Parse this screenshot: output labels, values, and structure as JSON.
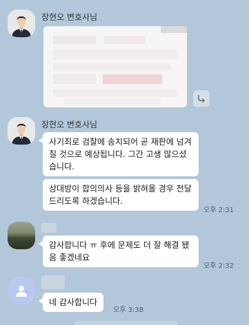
{
  "messages": [
    {
      "sender": "장현오 변호사님",
      "content_type": "image",
      "image_state": "blurred"
    },
    {
      "sender": "장현오 변호사님",
      "bubbles": [
        "사기죄로 검찰에 송치되어 곧 재판에 넘겨질 것으로 예상됩니다. 그간 고생 많으셨습니다.",
        "상대방이 합의의사 등을 밝혀올 경우 전달드리도록 하겠습니다."
      ],
      "time": "오후 2:31"
    },
    {
      "sender": "",
      "bubbles": [
        "감사합니다 ㅠ 후에 문제도 더 잘 해결 됐음 좋겠네요"
      ],
      "time": "오후 2:32"
    },
    {
      "sender": "",
      "bubbles": [
        "네 감사합니다"
      ],
      "time": "오후 3:38"
    }
  ],
  "icons": {
    "share": "share-arrow-icon",
    "default_avatar": "person-icon"
  },
  "colors": {
    "background": "#b2c7da",
    "bubble": "#ffffff",
    "default_avatar": "#b9c8f0"
  }
}
